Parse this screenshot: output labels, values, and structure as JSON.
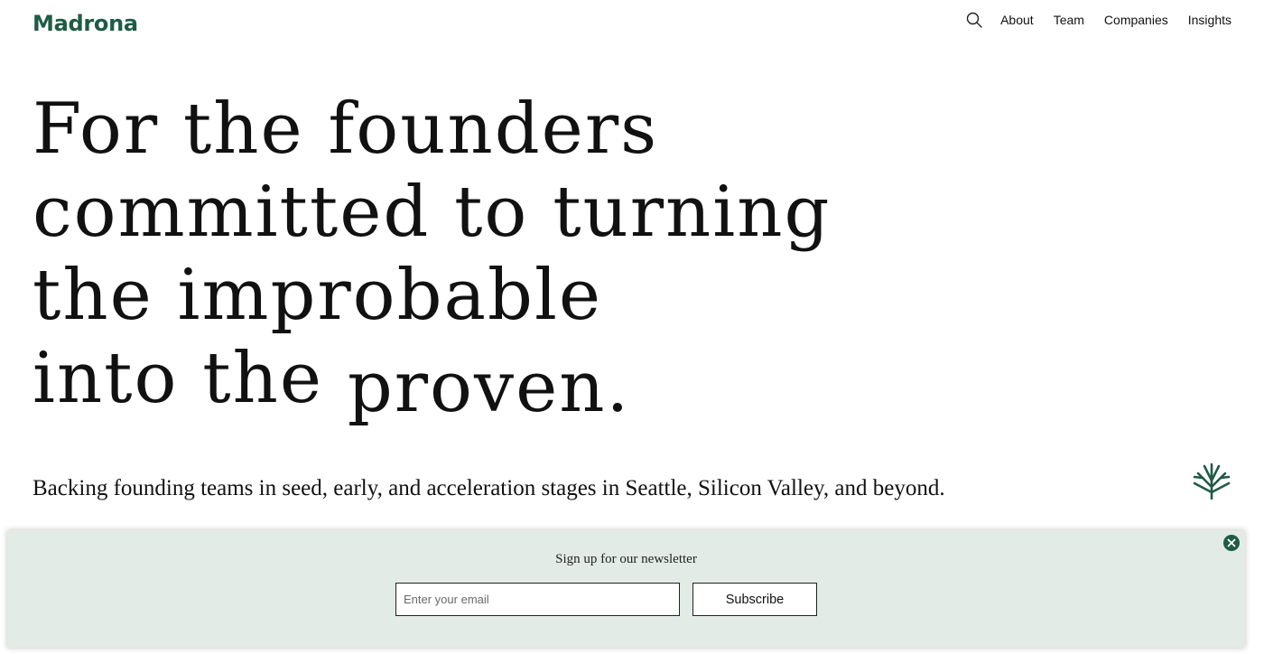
{
  "header": {
    "logo_text": "Madrona",
    "search_icon": "search-icon",
    "nav": [
      {
        "label": "About"
      },
      {
        "label": "Team"
      },
      {
        "label": "Companies"
      },
      {
        "label": "Insights"
      }
    ]
  },
  "hero": {
    "lines": [
      "For the founders",
      "committed to turning",
      "the improbable",
      "into the"
    ],
    "emphasis_word": "proven."
  },
  "tagline": "Backing founding teams in seed, early, and acceleration stages in Seattle, Silicon Valley, and beyond.",
  "brand_icon": "tree-icon",
  "newsletter": {
    "title": "Sign up for our newsletter",
    "email_placeholder": "Enter your email",
    "email_value": "",
    "subscribe_label": "Subscribe",
    "close_icon": "close-icon"
  },
  "colors": {
    "brand_green": "#1f5b45",
    "newsletter_bg": "#e3ebe6",
    "text": "#111111",
    "background": "#ffffff"
  }
}
